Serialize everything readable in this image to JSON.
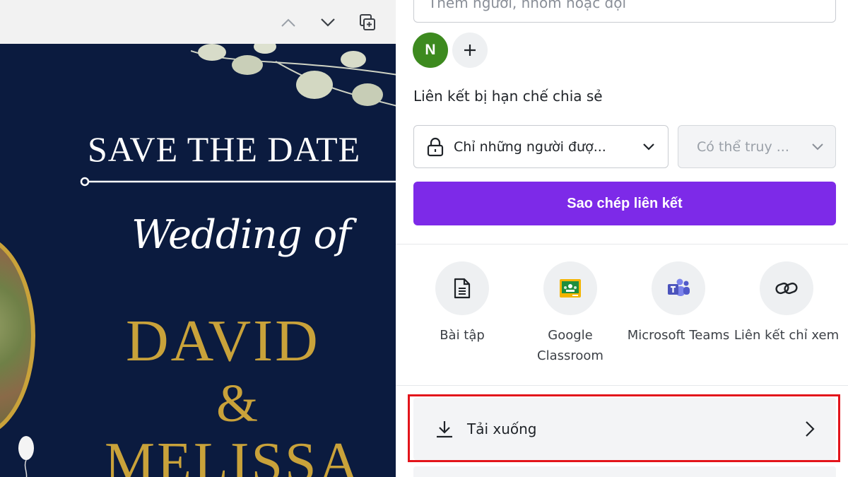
{
  "editor": {
    "toolbar": {
      "move_up_icon": "chevron-up-icon",
      "move_down_icon": "chevron-down-icon",
      "duplicate_icon": "duplicate-page-icon"
    },
    "design": {
      "headline": "SAVE THE DATE",
      "subhead": "Wedding of",
      "name_1": "DAVID",
      "ampersand": "&",
      "name_2": "MELISSA",
      "colors": {
        "background": "#0b1b3f",
        "gold": "#c9a23a",
        "text": "#ffffff"
      }
    }
  },
  "share_panel": {
    "search_placeholder": "Thêm người, nhóm hoặc đội",
    "collaborator_avatar": "N",
    "add_icon": "plus-icon",
    "link_heading": "Liên kết bị hạn chế chia sẻ",
    "access_select": {
      "value": "Chỉ những người đượ...",
      "icon": "lock-icon"
    },
    "permission_select": {
      "value": "Có thể truy ...",
      "disabled": true
    },
    "copy_link_label": "Sao chép liên kết",
    "share_options": [
      {
        "label": "Bài tập",
        "icon": "assignment-document-icon"
      },
      {
        "label": "Google Classroom",
        "icon": "google-classroom-icon"
      },
      {
        "label": "Microsoft Teams",
        "icon": "microsoft-teams-icon"
      },
      {
        "label": "Liên kết chỉ xem",
        "icon": "link-icon"
      }
    ],
    "download_label": "Tải xuống",
    "download_highlighted": true,
    "colors": {
      "primary": "#7d2ae8",
      "avatar": "#3d8a1f",
      "highlight": "#e3141b"
    }
  }
}
